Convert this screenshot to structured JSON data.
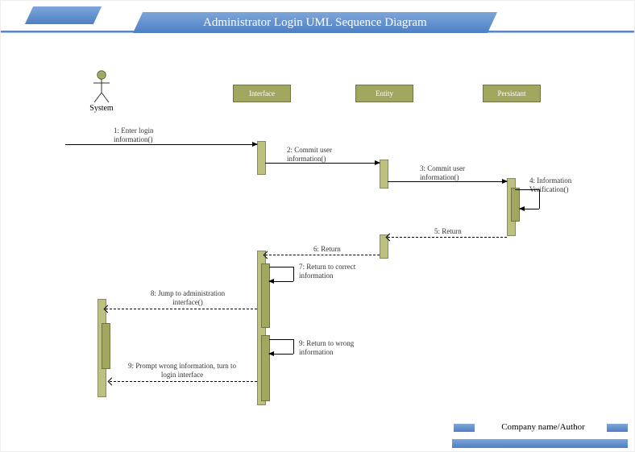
{
  "title": "Administrator Login UML Sequence Diagram",
  "actor": {
    "label": "System"
  },
  "lifelines": {
    "interface": "Interface",
    "entity": "Entity",
    "persistant": "Persistant"
  },
  "messages": {
    "m1": "1: Enter login information()",
    "m2": "2: Commit user information()",
    "m3": "3: Commit user information()",
    "m4": "4: Information Verification()",
    "m5": "5: Return",
    "m6": "6: Return",
    "m7": "7: Return to correct information",
    "m8": "8: Jump to administration interface()",
    "m9a": "9: Return to wrong information",
    "m9b": "9: Prompt wrong information, turn to login interface"
  },
  "footer": {
    "author": "Company name/Author"
  }
}
